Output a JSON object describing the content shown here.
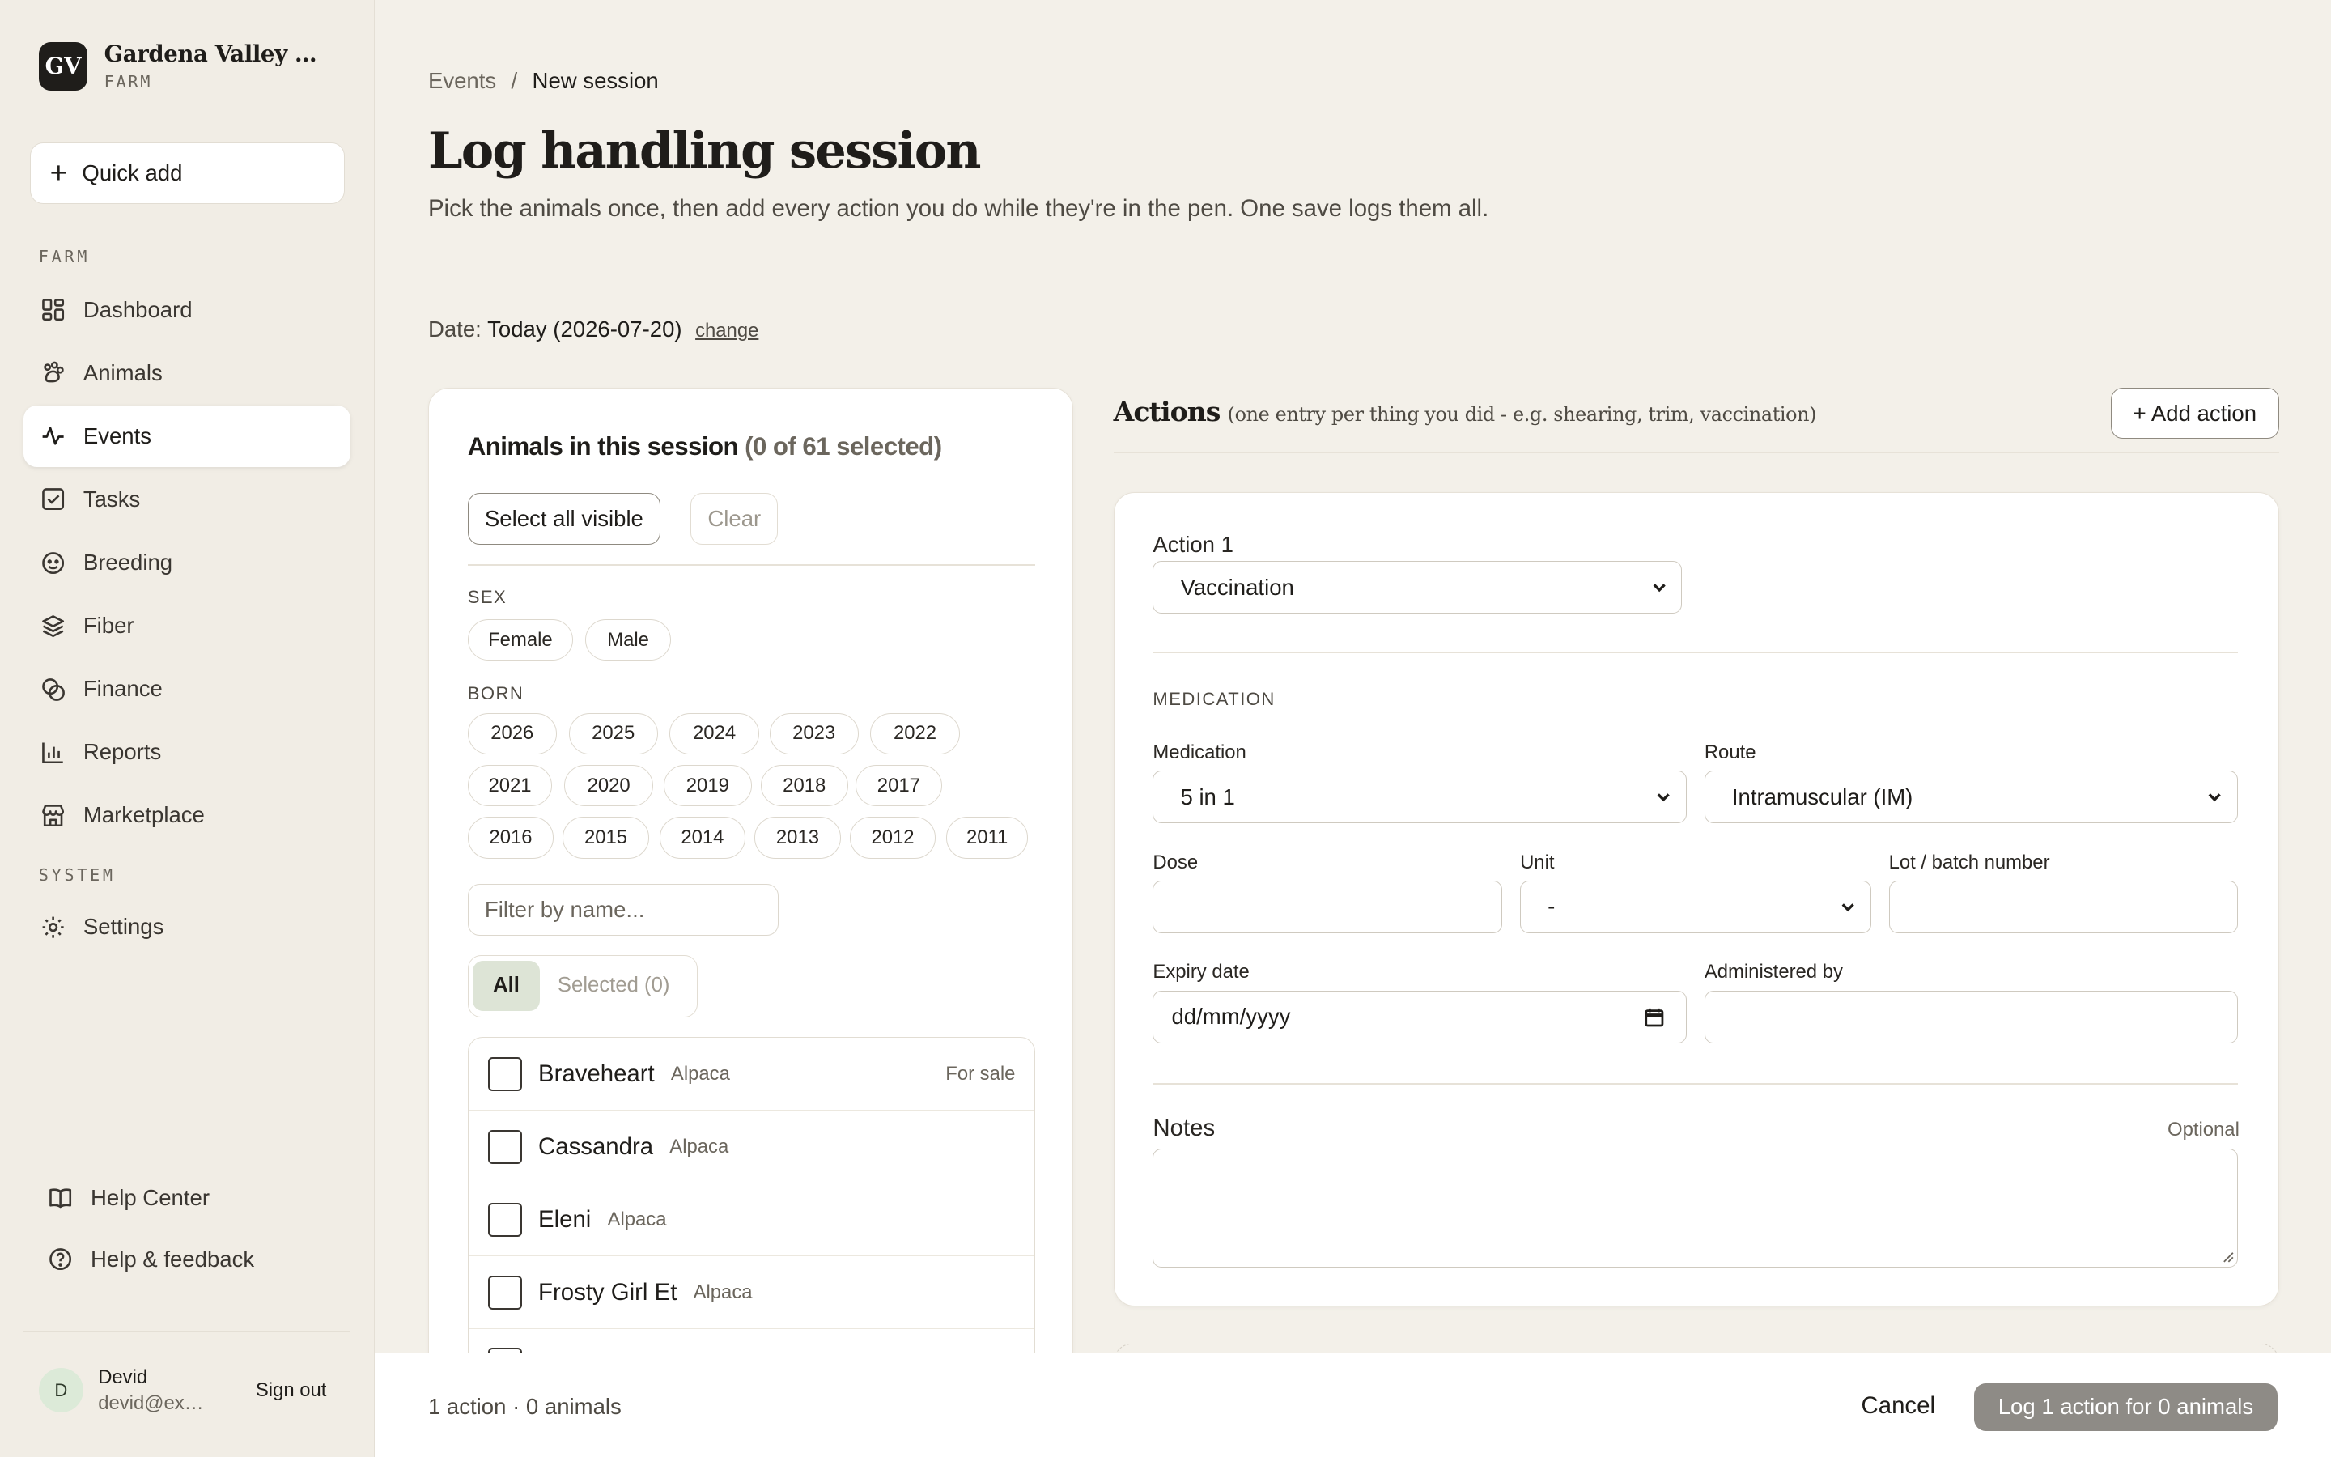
{
  "sidebar": {
    "brand_initials": "GV",
    "brand_name": "Gardena Valley Alp...",
    "brand_sub": "FARM",
    "quick_add": "Quick add",
    "farm_section": "FARM",
    "system_section": "SYSTEM",
    "items": [
      {
        "label": "Dashboard",
        "icon": "dashboard-icon"
      },
      {
        "label": "Animals",
        "icon": "paw-icon"
      },
      {
        "label": "Events",
        "icon": "activity-icon"
      },
      {
        "label": "Tasks",
        "icon": "checkbox-icon"
      },
      {
        "label": "Breeding",
        "icon": "breeding-icon"
      },
      {
        "label": "Fiber",
        "icon": "layers-icon"
      },
      {
        "label": "Finance",
        "icon": "coins-icon"
      },
      {
        "label": "Reports",
        "icon": "bar-chart-icon"
      },
      {
        "label": "Marketplace",
        "icon": "store-icon"
      }
    ],
    "settings": "Settings",
    "help_center": "Help Center",
    "help_feedback": "Help & feedback",
    "user": {
      "initial": "D",
      "name": "Devid",
      "email": "devid@example.com",
      "sign_out": "Sign out"
    }
  },
  "header": {
    "breadcrumb_parent": "Events",
    "breadcrumb_sep": "/",
    "breadcrumb_current": "New session",
    "title": "Log handling session",
    "subtitle": "Pick the animals once, then add every action you do while they're in the pen. One save logs them all.",
    "date_label": "Date:",
    "date_value": "Today (2026-07-20)",
    "date_change": "change"
  },
  "animals": {
    "title": "Animals in this session",
    "count": "(0 of 61 selected)",
    "select_all": "Select all visible",
    "clear": "Clear",
    "sex_label": "SEX",
    "sex_options": [
      "Female",
      "Male"
    ],
    "born_label": "BORN",
    "years_row1": [
      "2026",
      "2025",
      "2024",
      "2023",
      "2022"
    ],
    "years_row2": [
      "2021",
      "2020",
      "2019",
      "2018",
      "2017"
    ],
    "years_row3": [
      "2016",
      "2015",
      "2014",
      "2013",
      "2012",
      "2011"
    ],
    "filter_placeholder": "Filter by name...",
    "tab_all": "All",
    "tab_selected": "Selected (0)",
    "list": [
      {
        "name": "Braveheart",
        "species": "Alpaca",
        "tag": "For sale"
      },
      {
        "name": "Cassandra",
        "species": "Alpaca",
        "tag": ""
      },
      {
        "name": "Eleni",
        "species": "Alpaca",
        "tag": ""
      },
      {
        "name": "Frosty Girl Et",
        "species": "Alpaca",
        "tag": ""
      }
    ]
  },
  "actions": {
    "title": "Actions",
    "hint": "(one entry per thing you did - e.g. shearing, trim, vaccination)",
    "add_action": "+ Add action",
    "action_label": "Action 1",
    "action_type": "Vaccination",
    "medication_section": "MEDICATION",
    "medication_label": "Medication",
    "medication_value": "5 in 1",
    "route_label": "Route",
    "route_value": "Intramuscular (IM)",
    "dose_label": "Dose",
    "unit_label": "Unit",
    "unit_value": "-",
    "lot_label": "Lot / batch number",
    "expiry_label": "Expiry date",
    "expiry_placeholder": "dd/mm/yyyy",
    "administered_label": "Administered by",
    "notes_label": "Notes",
    "notes_optional": "Optional"
  },
  "footer": {
    "summary": "1 action · 0 animals",
    "cancel": "Cancel",
    "submit": "Log 1 action for 0 animals"
  }
}
